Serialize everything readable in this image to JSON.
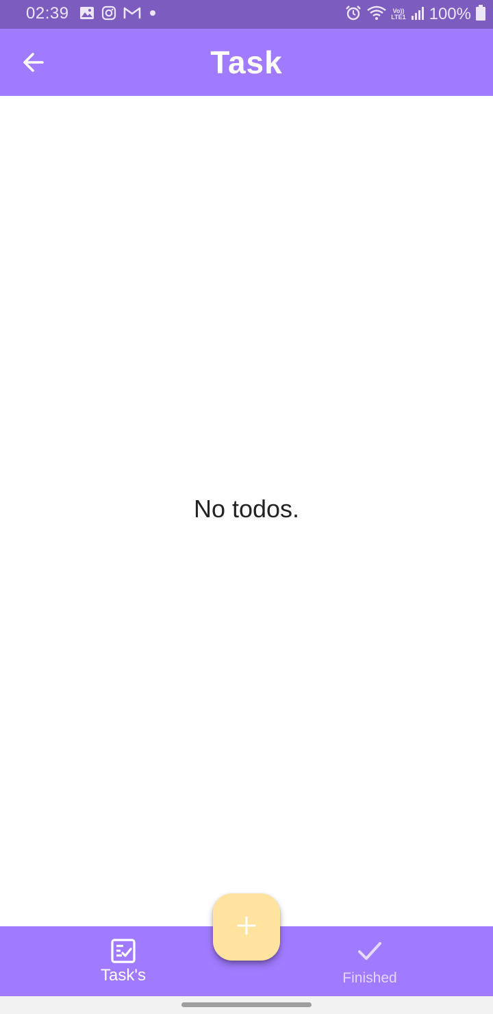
{
  "status_bar": {
    "time": "02:39",
    "battery": "100%",
    "volte_top": "Vo))",
    "volte_bottom": "LTE1",
    "background": "#7C5CBF",
    "left_icons": [
      "gallery-icon",
      "instagram-icon",
      "gmail-icon",
      "dot-icon"
    ],
    "right_icons": [
      "alarm-icon",
      "wifi-icon",
      "volte-icon",
      "signal-icon",
      "battery-icon"
    ]
  },
  "app_bar": {
    "title": "Task",
    "back_icon": "arrow-left-icon",
    "background": "#A17BFF"
  },
  "main": {
    "empty_message": "No todos."
  },
  "fab": {
    "icon": "plus-icon",
    "background": "#FFE39E"
  },
  "bottom_nav": {
    "background": "#A17BFF",
    "items": [
      {
        "label": "Task's",
        "icon": "task-list-icon",
        "selected": true
      },
      {
        "label": "Finished",
        "icon": "check-icon",
        "selected": false
      }
    ]
  }
}
